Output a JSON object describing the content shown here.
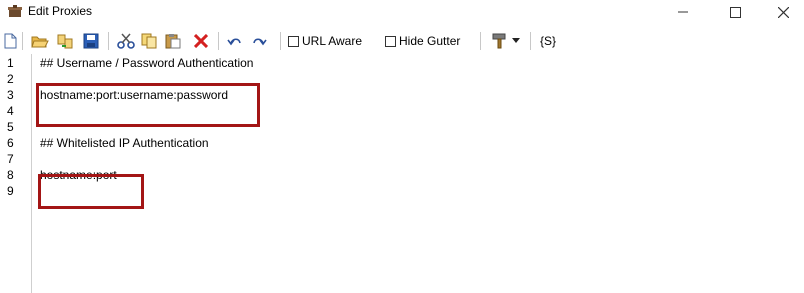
{
  "window": {
    "title": "Edit Proxies",
    "controls": {
      "minimize": "—",
      "maximize": "☐",
      "close": "✕"
    }
  },
  "toolbar": {
    "url_aware_label": "URL Aware",
    "url_aware_checked": false,
    "hide_gutter_label": "Hide Gutter",
    "hide_gutter_checked": false,
    "snippet_label": "{S}"
  },
  "editor": {
    "line_numbers": [
      "1",
      "2",
      "3",
      "4",
      "5",
      "6",
      "7",
      "8",
      "9"
    ],
    "lines": [
      "## Username / Password Authentication",
      "",
      "hostname:port:username:password",
      "",
      "",
      "## Whitelisted IP Authentication",
      "",
      "hostname:port",
      ""
    ],
    "highlight_color": "#a31515"
  }
}
